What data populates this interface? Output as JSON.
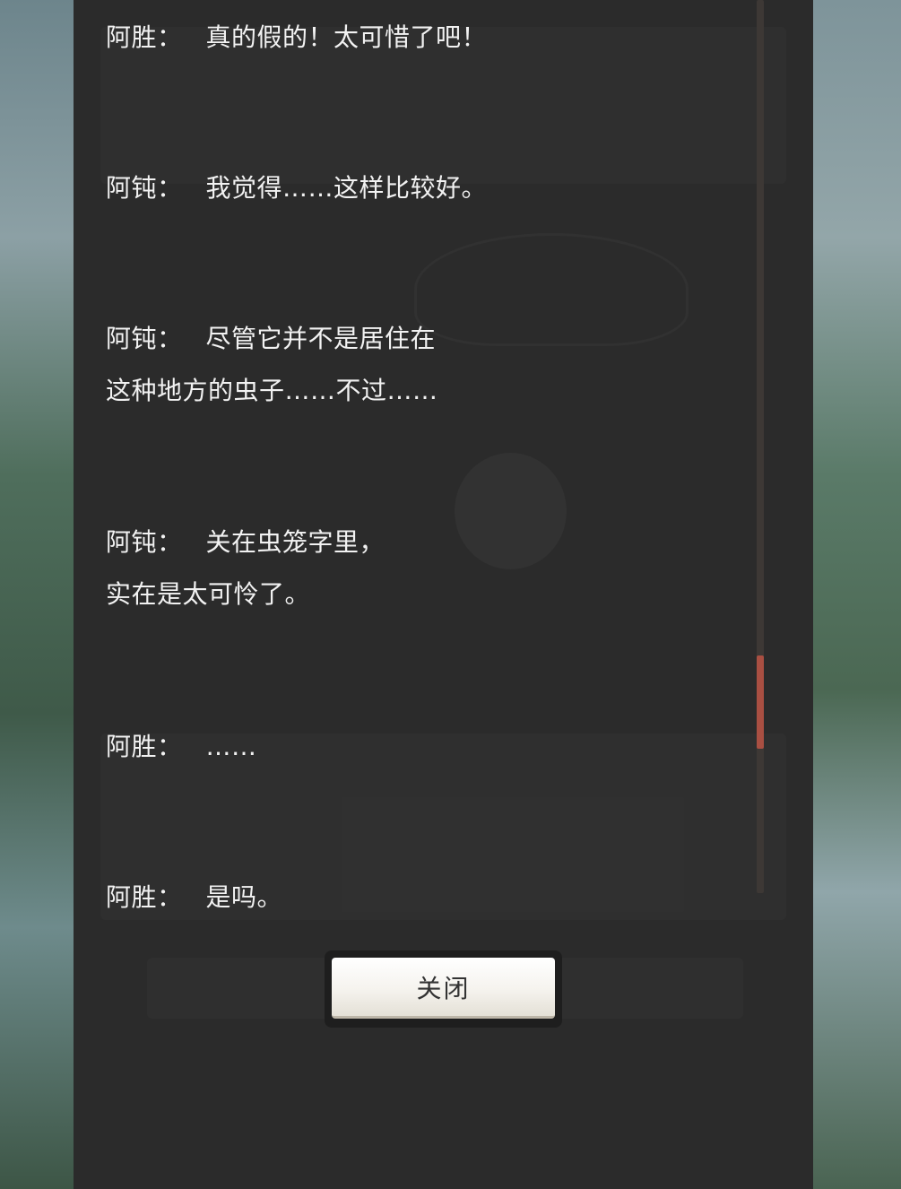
{
  "dialogue_log": [
    {
      "speaker": "阿胜：",
      "lines": [
        "真的假的！太可惜了吧！"
      ]
    },
    {
      "speaker": "阿钝：",
      "lines": [
        "我觉得……这样比较好。"
      ]
    },
    {
      "speaker": "阿钝：",
      "lines": [
        "尽管它并不是居住在",
        "这种地方的虫子……不过……"
      ]
    },
    {
      "speaker": "阿钝：",
      "lines": [
        "关在虫笼字里，",
        "实在是太可怜了。"
      ]
    },
    {
      "speaker": "阿胜：",
      "lines": [
        "……"
      ]
    },
    {
      "speaker": "阿胜：",
      "lines": [
        "是吗。"
      ]
    }
  ],
  "scroll": {
    "position": 0.82
  },
  "buttons": {
    "close_label": "关闭"
  },
  "colors": {
    "panel_bg": "#2b2b2b",
    "text": "#f2f2f2",
    "scroll_thumb": "#a94f42",
    "scroll_track": "#3d3835"
  }
}
